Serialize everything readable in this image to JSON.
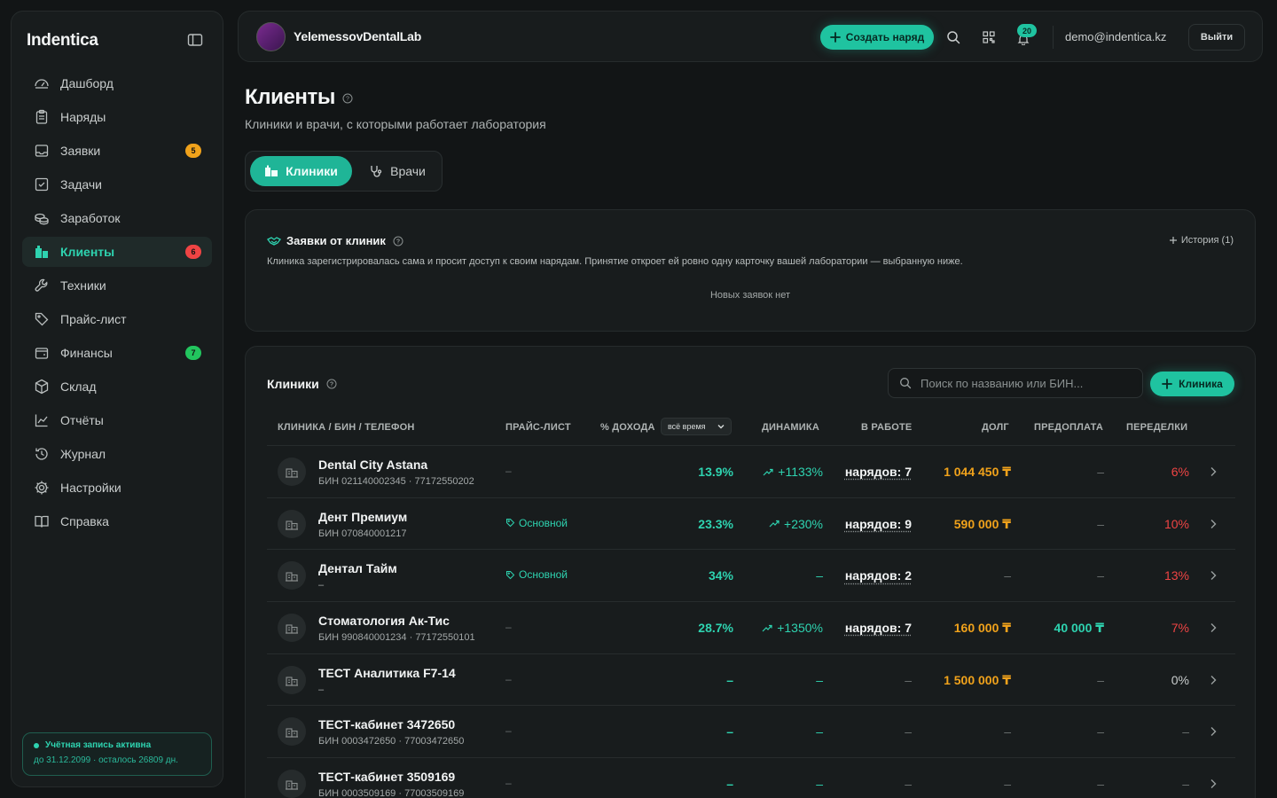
{
  "app": {
    "brand": "Indentica"
  },
  "sidebar": {
    "items": [
      {
        "label": "Дашборд",
        "icon": "dashboard-icon"
      },
      {
        "label": "Наряды",
        "icon": "clipboard-icon"
      },
      {
        "label": "Заявки",
        "icon": "inbox-icon",
        "badge": "5",
        "badge_color": "#f0a21b"
      },
      {
        "label": "Задачи",
        "icon": "checkbox-icon"
      },
      {
        "label": "Заработок",
        "icon": "coins-icon"
      },
      {
        "label": "Клиенты",
        "icon": "building-icon",
        "badge": "6",
        "badge_color": "#ef4444",
        "active": true
      },
      {
        "label": "Техники",
        "icon": "wrench-icon"
      },
      {
        "label": "Прайс-лист",
        "icon": "tag-icon"
      },
      {
        "label": "Финансы",
        "icon": "wallet-icon",
        "badge": "7",
        "badge_color": "#22c55e"
      },
      {
        "label": "Склад",
        "icon": "box-icon"
      },
      {
        "label": "Отчёты",
        "icon": "chart-line-icon"
      },
      {
        "label": "Журнал",
        "icon": "history-icon"
      },
      {
        "label": "Настройки",
        "icon": "gear-icon"
      },
      {
        "label": "Справка",
        "icon": "book-icon"
      }
    ],
    "account": {
      "status": "Учётная запись активна",
      "until": "до 31.12.2099 · осталось 26809 дн."
    }
  },
  "topbar": {
    "lab_name": "YelemessovDentalLab",
    "create_label": "Создать наряд",
    "notifications_count": "20",
    "email": "demo@indentica.kz",
    "logout_label": "Выйти"
  },
  "page": {
    "title": "Клиенты",
    "subtitle": "Клиники и врачи, с которыми работает лаборатория",
    "tabs": [
      {
        "label": "Клиники"
      },
      {
        "label": "Врачи"
      }
    ]
  },
  "requests": {
    "title": "Заявки от клиник",
    "history_label": "История (1)",
    "description": "Клиника зарегистрировалась сама и просит доступ к своим нарядам. Принятие откроет ей ровно одну карточку вашей лаборатории — выбранную ниже.",
    "empty": "Новых заявок нет"
  },
  "clinics": {
    "title": "Клиники",
    "search_placeholder": "Поиск по названию или БИН...",
    "add_label": "Клиника",
    "period": "всё время",
    "columns": {
      "clinic": "КЛИНИКА / БИН / ТЕЛЕФОН",
      "price": "ПРАЙС-ЛИСТ",
      "income": "% ДОХОДА",
      "dynamics": "ДИНАМИКА",
      "work": "В РАБОТЕ",
      "debt": "ДОЛГ",
      "prepay": "ПРЕДОПЛАТА",
      "redo": "ПЕРЕДЕЛКИ"
    },
    "rows": [
      {
        "name": "Dental City Astana",
        "sub": "БИН 021140002345 · 77172550202",
        "price": "–",
        "income": "13.9%",
        "dynamics": "+1133%",
        "work": "нарядов: 7",
        "debt": "1 044 450 ₸",
        "prepay": "–",
        "redo": "6%"
      },
      {
        "name": "Дент Премиум",
        "sub": "БИН 070840001217",
        "price": "Основной",
        "income": "23.3%",
        "dynamics": "+230%",
        "work": "нарядов: 9",
        "debt": "590 000 ₸",
        "prepay": "–",
        "redo": "10%"
      },
      {
        "name": "Дентал Тайм",
        "sub": "–",
        "price": "Основной",
        "income": "34%",
        "dynamics": "–",
        "work": "нарядов: 2",
        "debt": "–",
        "prepay": "–",
        "redo": "13%"
      },
      {
        "name": "Стоматология Ак-Тис",
        "sub": "БИН 990840001234 · 77172550101",
        "price": "–",
        "income": "28.7%",
        "dynamics": "+1350%",
        "work": "нарядов: 7",
        "debt": "160 000 ₸",
        "prepay": "40 000 ₸",
        "redo": "7%"
      },
      {
        "name": "ТЕСТ Аналитика F7-14",
        "sub": "–",
        "price": "–",
        "income": "–",
        "dynamics": "–",
        "work": "–",
        "debt": "1 500 000 ₸",
        "prepay": "–",
        "redo": "0%"
      },
      {
        "name": "ТЕСТ-кабинет 3472650",
        "sub": "БИН 0003472650 · 77003472650",
        "price": "–",
        "income": "–",
        "dynamics": "–",
        "work": "–",
        "debt": "–",
        "prepay": "–",
        "redo": "–"
      },
      {
        "name": "ТЕСТ-кабинет 3509169",
        "sub": "БИН 0003509169 · 77003509169",
        "price": "–",
        "income": "–",
        "dynamics": "–",
        "work": "–",
        "debt": "–",
        "prepay": "–",
        "redo": "–"
      }
    ]
  }
}
